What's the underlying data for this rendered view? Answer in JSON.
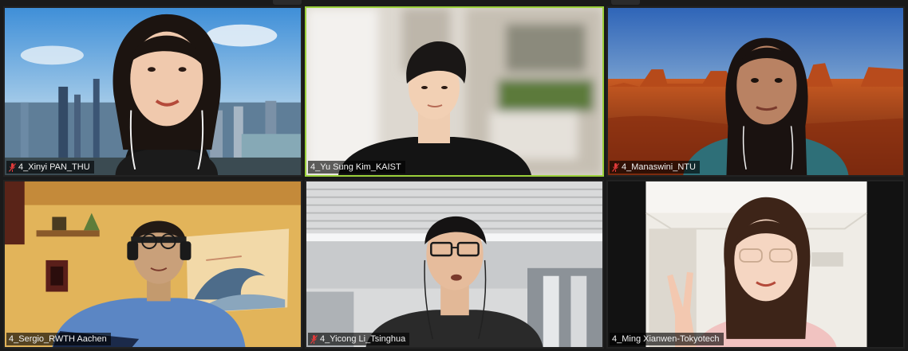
{
  "meeting": {
    "participants": [
      {
        "name": "4_Xinyi PAN_THU",
        "muted": true,
        "scene": "city-virtual-background"
      },
      {
        "name": "4_Yu Sung Kim_KAIST",
        "muted": false,
        "active_speaker": true,
        "scene": "blurred-room"
      },
      {
        "name": "4_Manaswini_NTU",
        "muted": true,
        "scene": "desert-virtual-background"
      },
      {
        "name": "4_Sergio_RWTH Aachen",
        "muted": false,
        "scene": "room-with-wave-tapestry"
      },
      {
        "name": "4_Yicong Li_Tsinghua",
        "muted": true,
        "scene": "office-ceiling"
      },
      {
        "name": "4_Ming Xianwen-Tokyotech",
        "muted": false,
        "scene": "room-with-cabinet"
      }
    ]
  },
  "colors": {
    "active_speaker_border": "#9bd03a",
    "muted_icon": "#e03a3a",
    "tile_label_bg": "#000000"
  },
  "icons": {
    "muted": "muted-microphone-icon"
  }
}
